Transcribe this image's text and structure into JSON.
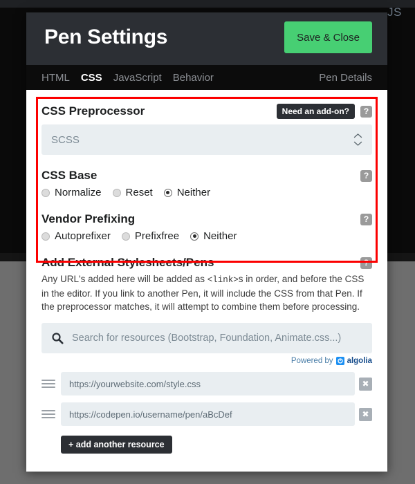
{
  "backdrop": {
    "js_tab_label": "JS"
  },
  "header": {
    "title": "Pen Settings",
    "save_label": "Save & Close"
  },
  "tabs": [
    {
      "label": "HTML",
      "active": false
    },
    {
      "label": "CSS",
      "active": true
    },
    {
      "label": "JavaScript",
      "active": false
    },
    {
      "label": "Behavior",
      "active": false
    }
  ],
  "pen_details_label": "Pen Details",
  "preprocessor": {
    "title": "CSS Preprocessor",
    "addon_badge": "Need an add-on?",
    "help": "?",
    "selected": "SCSS"
  },
  "css_base": {
    "title": "CSS Base",
    "help": "?",
    "options": [
      {
        "label": "Normalize",
        "selected": false
      },
      {
        "label": "Reset",
        "selected": false
      },
      {
        "label": "Neither",
        "selected": true
      }
    ]
  },
  "vendor_prefixing": {
    "title": "Vendor Prefixing",
    "help": "?",
    "options": [
      {
        "label": "Autoprefixer",
        "selected": false
      },
      {
        "label": "Prefixfree",
        "selected": false
      },
      {
        "label": "Neither",
        "selected": true
      }
    ]
  },
  "external": {
    "title": "Add External Stylesheets/Pens",
    "help": "?",
    "desc_part1": "Any URL's added here will be added as ",
    "desc_code": "<link>",
    "desc_part2": "s in order, and before the CSS in the editor. If you link to another Pen, it will include the CSS from that Pen. If the preprocessor matches, it will attempt to combine them before processing.",
    "search_placeholder": "Search for resources (Bootstrap, Foundation, Animate.css...)",
    "powered_by": "Powered by",
    "algolia_name": "algolia",
    "resources": [
      {
        "url": "https://yourwebsite.com/style.css",
        "delete_label": "✖"
      },
      {
        "url": "https://codepen.io/username/pen/aBcDef",
        "delete_label": "✖"
      }
    ],
    "add_button": "+ add another resource"
  },
  "colors": {
    "accent_green": "#47cf73",
    "header_dark": "#2c2f34",
    "tabbar_dark": "#0c0c0c",
    "annotation_red": "#fc0000",
    "field_bg": "#e9eef1"
  }
}
